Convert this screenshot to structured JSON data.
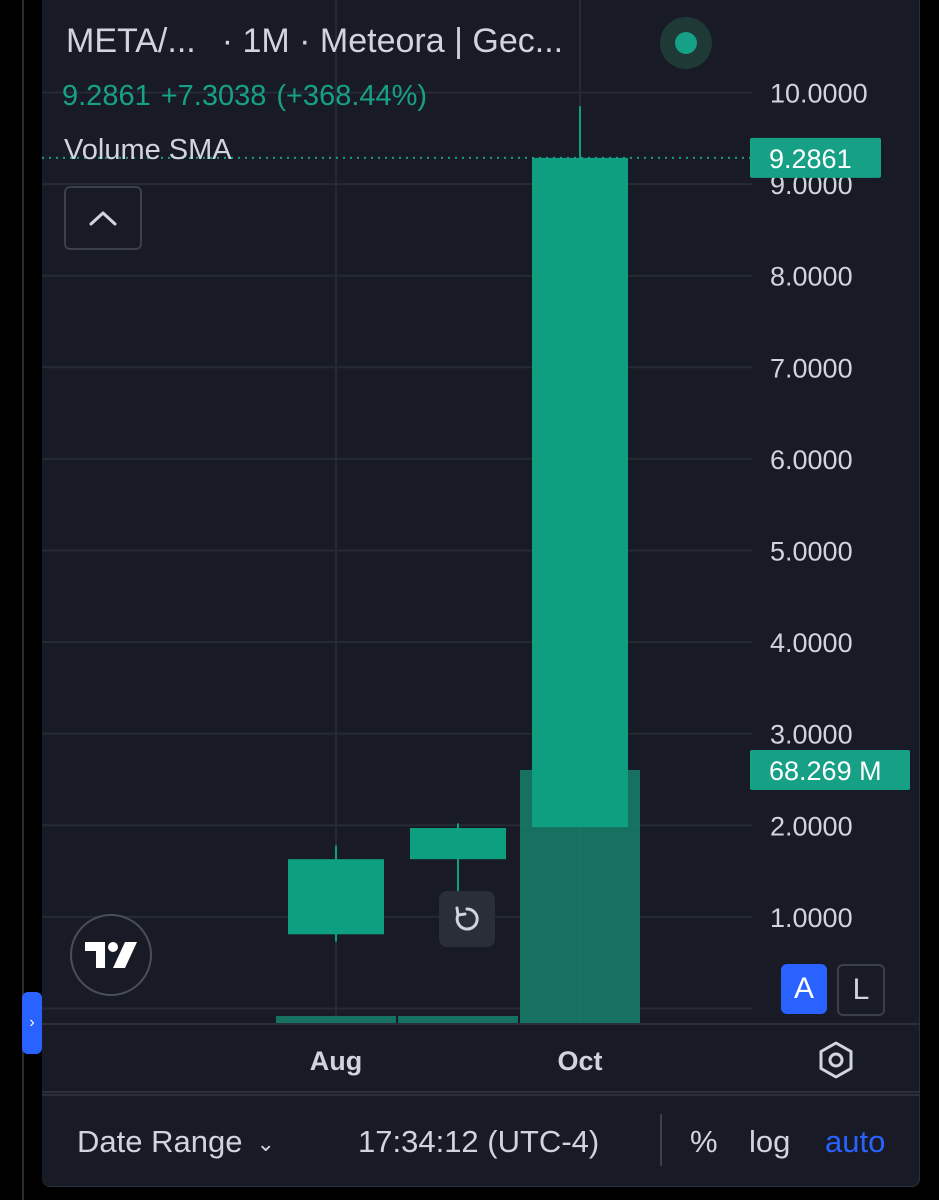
{
  "header": {
    "symbol": "META/...",
    "meta": "· 1M · Meteora | Gec...",
    "last_price": "9.2861",
    "change": "+7.3038",
    "change_pct": "(+368.44%)",
    "indicator": "Volume SMA"
  },
  "colors": {
    "bg": "#181b25",
    "up": "#0e9f80",
    "volume": "#16806c",
    "accent": "#2962ff",
    "text": "#d1d4dc",
    "grid": "#262a35"
  },
  "icons": {
    "collapse": "chevron-up-icon",
    "reset": "reset-icon",
    "settings": "gear-icon",
    "logo": "tradingview-logo"
  },
  "axis_controls": {
    "auto_label": "A",
    "log_label": "L"
  },
  "footer": {
    "date_range": "Date Range",
    "time": "17:34:12 (UTC-4)",
    "percent": "%",
    "log": "log",
    "auto": "auto"
  },
  "chart_data": {
    "type": "candlestick",
    "interval": "1M",
    "x_labels": [
      "Aug",
      "Oct"
    ],
    "price_ticks": [
      "10.0000",
      "9.0000",
      "8.0000",
      "7.0000",
      "6.0000",
      "5.0000",
      "4.0000",
      "3.0000",
      "2.0000",
      "1.0000"
    ],
    "ylim": [
      -0.2,
      10.4
    ],
    "candles": [
      {
        "open": 0.81,
        "high": 1.78,
        "low": 0.73,
        "close": 1.63,
        "volume_m": 0.6
      },
      {
        "open": 1.63,
        "high": 2.02,
        "low": 1.27,
        "close": 1.97,
        "volume_m": 0.6
      },
      {
        "open": 1.98,
        "high": 9.85,
        "low": 1.98,
        "close": 9.2861,
        "volume_m": 68.269
      }
    ],
    "last_price_label": "9.2861",
    "last_volume_label": "68.269 M"
  }
}
